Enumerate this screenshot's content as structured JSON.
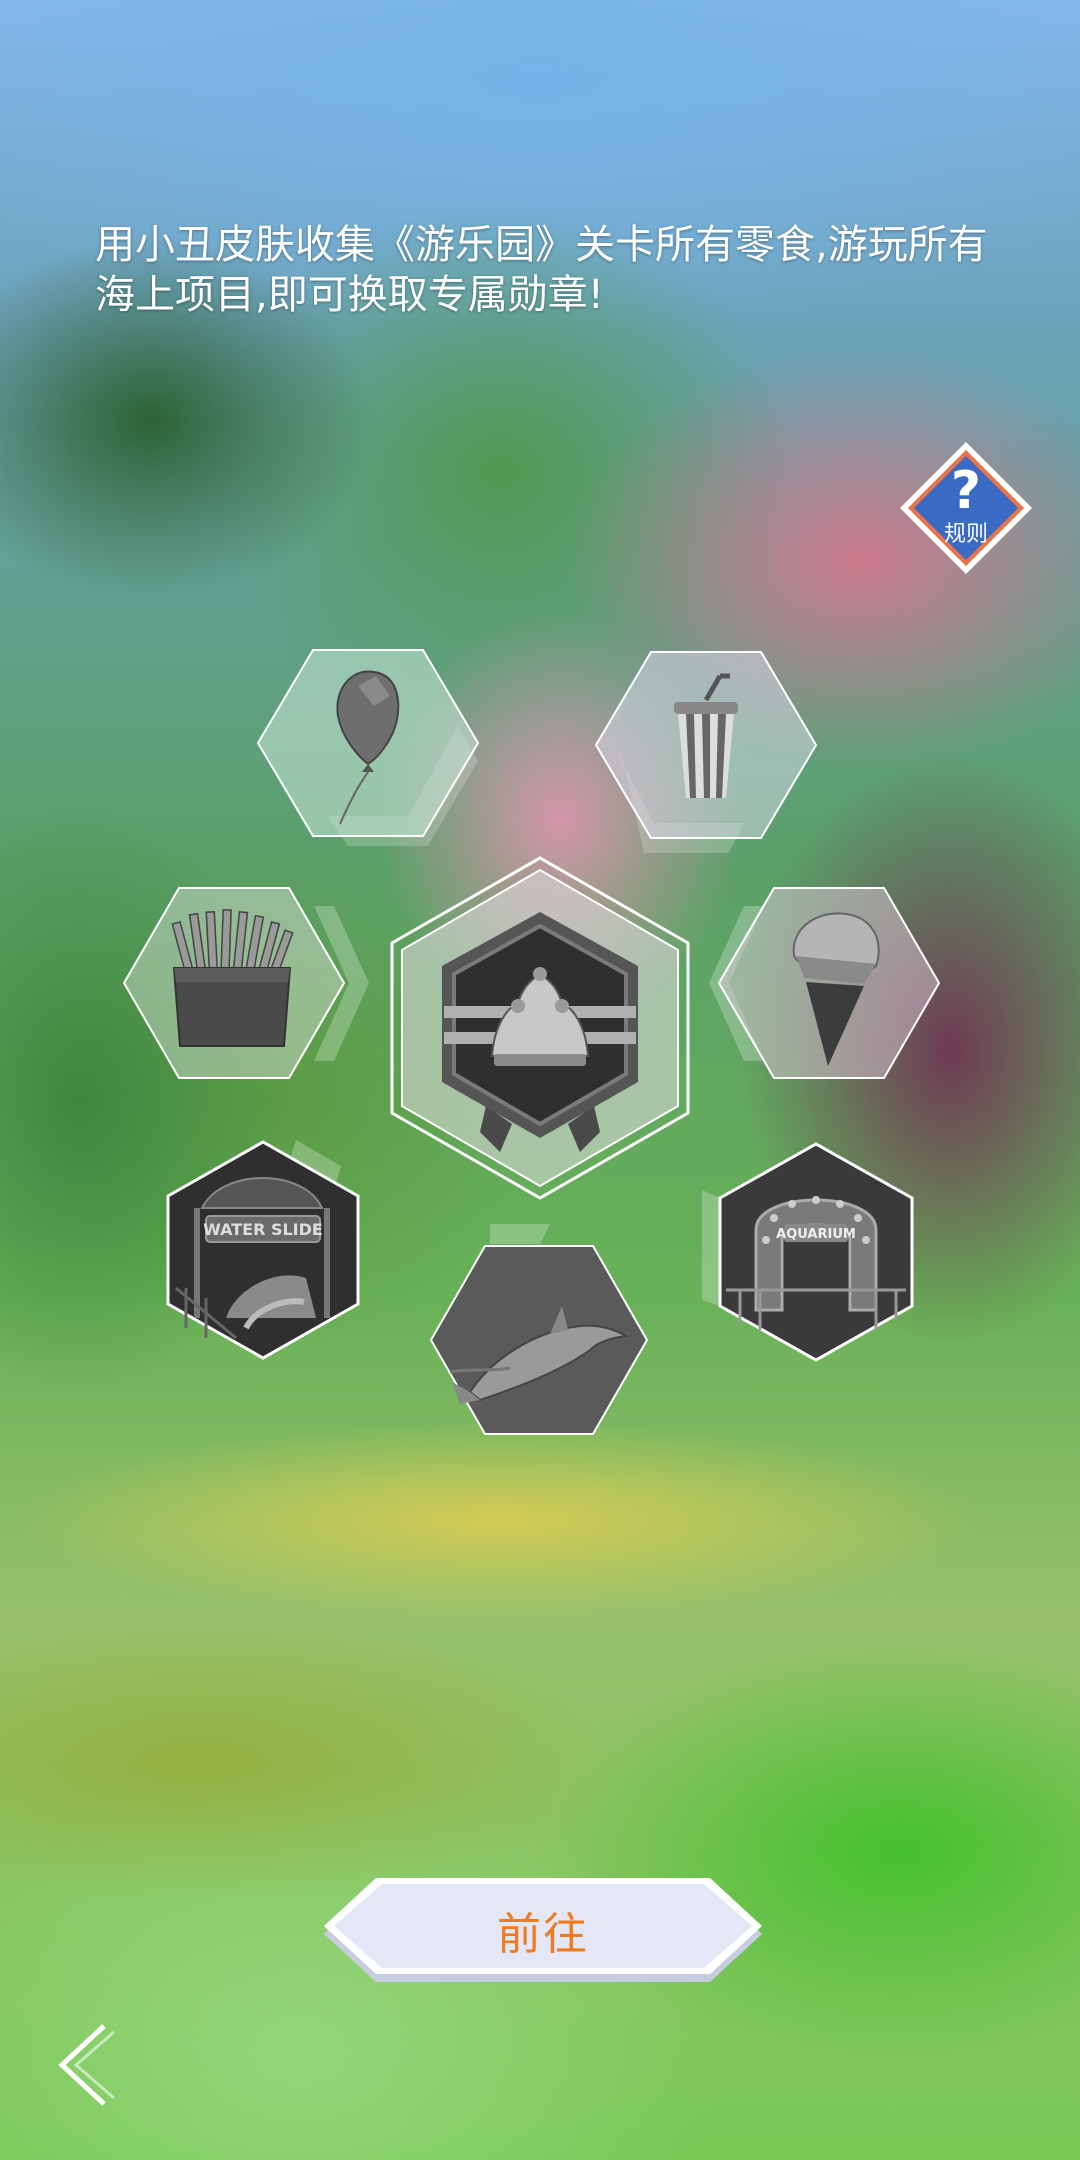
{
  "description": "用小丑皮肤收集《游乐园》关卡所有零食,游玩所有海上项目,即可换取专属勋章!",
  "rules_button": {
    "icon": "question-mark-icon",
    "label": "规则",
    "color": "#3a6bc4",
    "border": "#e8734a"
  },
  "badge": {
    "icon": "jester-hat-badge-icon",
    "locked": true
  },
  "items": [
    {
      "name": "balloon",
      "icon": "balloon-icon",
      "collected": false
    },
    {
      "name": "drink-cup",
      "icon": "drink-cup-icon",
      "collected": false
    },
    {
      "name": "french-fries",
      "icon": "french-fries-icon",
      "collected": false
    },
    {
      "name": "ice-cream",
      "icon": "ice-cream-icon",
      "collected": false
    },
    {
      "name": "water-slide",
      "icon": "water-slide-icon",
      "sign_text": "WATER SLIDE",
      "collected": false
    },
    {
      "name": "dolphin",
      "icon": "dolphin-icon",
      "collected": false
    },
    {
      "name": "aquarium",
      "icon": "aquarium-icon",
      "sign_text": "AQUARIUM",
      "collected": false
    }
  ],
  "goto_button": {
    "label": "前往",
    "text_color": "#f07a20"
  },
  "back_button": {
    "icon": "back-chevron-icon"
  }
}
